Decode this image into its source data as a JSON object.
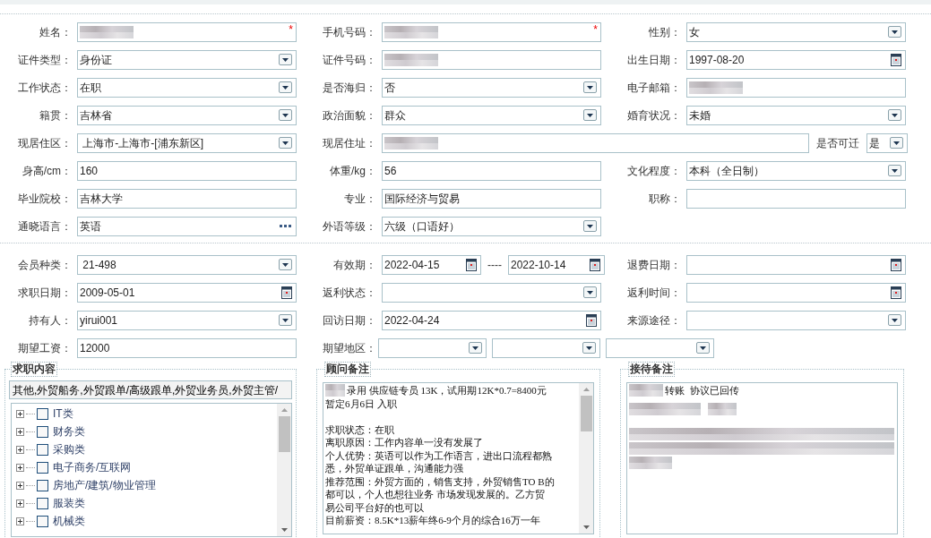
{
  "sections": [
    {
      "rows": [
        [
          {
            "label": "姓名：",
            "kind": "text",
            "redacted": true,
            "marker": "*"
          },
          {
            "label": "手机号码：",
            "kind": "text",
            "redacted": true,
            "marker": "*"
          },
          {
            "label": "性别：",
            "kind": "select",
            "value": "女"
          }
        ],
        [
          {
            "label": "证件类型：",
            "kind": "select",
            "value": "身份证"
          },
          {
            "label": "证件号码：",
            "kind": "text",
            "redacted": true
          },
          {
            "label": "出生日期：",
            "kind": "date",
            "value": "1997-08-20"
          }
        ],
        [
          {
            "label": "工作状态：",
            "kind": "select",
            "value": "在职"
          },
          {
            "label": "是否海归：",
            "kind": "select",
            "value": "否"
          },
          {
            "label": "电子邮箱：",
            "kind": "text",
            "redacted": true
          }
        ],
        [
          {
            "label": "籍贯：",
            "kind": "select",
            "value": "吉林省"
          },
          {
            "label": "政治面貌：",
            "kind": "select",
            "value": "群众"
          },
          {
            "label": "婚育状况：",
            "kind": "select",
            "value": "未婚"
          }
        ],
        [
          {
            "label": "现居住区：",
            "kind": "select",
            "value": " 上海市-上海市-[浦东新区]"
          },
          {
            "label": "现居住址：",
            "kind": "text",
            "redacted": true,
            "inline": {
              "label": "是否可迁",
              "kind": "select",
              "value": "是"
            }
          }
        ],
        [
          {
            "label": "身高/cm：",
            "kind": "text",
            "value": "160"
          },
          {
            "label": "体重/kg：",
            "kind": "text",
            "value": "56"
          },
          {
            "label": "文化程度：",
            "kind": "select",
            "value": "本科（全日制）"
          }
        ],
        [
          {
            "label": "毕业院校：",
            "kind": "text",
            "value": "吉林大学"
          },
          {
            "label": "专业：",
            "kind": "text",
            "value": "国际经济与贸易"
          },
          {
            "label": "职称：",
            "kind": "text"
          }
        ],
        [
          {
            "label": "通晓语言：",
            "kind": "picker",
            "value": "英语"
          },
          {
            "label": "外语等级：",
            "kind": "select",
            "value": "六级（口语好）"
          }
        ]
      ]
    },
    {
      "rows": [
        [
          {
            "label": "会员种类：",
            "kind": "select",
            "value": " 21-498"
          },
          {
            "label": "有效期：",
            "kind": "daterange",
            "values": [
              "2022-04-15",
              "2022-10-14"
            ],
            "separator": "----"
          },
          {
            "label": "退费日期：",
            "kind": "date"
          }
        ],
        [
          {
            "label": "求职日期：",
            "kind": "date",
            "value": "2009-05-01"
          },
          {
            "label": "返利状态：",
            "kind": "select"
          },
          {
            "label": "返利时间：",
            "kind": "date"
          }
        ],
        [
          {
            "label": "持有人：",
            "kind": "select",
            "value": "yirui001"
          },
          {
            "label": "回访日期：",
            "kind": "date",
            "value": "2022-04-24"
          },
          {
            "label": "来源途径：",
            "kind": "select"
          }
        ],
        [
          {
            "label": "期望工资：",
            "kind": "text",
            "value": "12000"
          },
          {
            "label": "期望地区：",
            "kind": "multiselect",
            "dropdowns": [
              {
                "kind": "select"
              },
              {
                "kind": "select"
              },
              {
                "kind": "select"
              }
            ]
          }
        ]
      ]
    }
  ],
  "panels": [
    {
      "kind": "tree",
      "legend": "求职内容",
      "summary": "其他,外贸船务,外贸跟单/高级跟单,外贸业务员,外贸主管/",
      "items": [
        {
          "label": "IT类",
          "checked": false,
          "expanded": false
        },
        {
          "label": "财务类",
          "checked": false,
          "expanded": false
        },
        {
          "label": "采购类",
          "checked": false,
          "expanded": false
        },
        {
          "label": "电子商务/互联网",
          "checked": false,
          "expanded": false
        },
        {
          "label": "房地产/建筑/物业管理",
          "checked": false,
          "expanded": false
        },
        {
          "label": "服装类",
          "checked": false,
          "expanded": false
        },
        {
          "label": "机械类",
          "checked": false,
          "expanded": false
        }
      ]
    },
    {
      "kind": "notes",
      "legend": "顾问备注",
      "redacted_start": true,
      "scrollbar": true,
      "paragraphs": [
        [
          "录用 供应链专员 13K，试用期12K*0.7=8400元",
          "暂定6月6日 入职"
        ],
        [
          "求职状态：在职",
          "离职原因：工作内容单一没有发展了",
          "个人优势：英语可以作为工作语言，进出口流程都熟",
          "悉，外贸单证跟单，沟通能力强",
          "推荐范围：外贸方面的，销售支持，外贸销售TO B的",
          "都可以，个人也想往业务 市场发现发展的。乙方贸",
          "易公司平台好的也可以",
          "目前薪资：8.5K*13薪年终6-9个月的综合16万一年"
        ]
      ]
    },
    {
      "kind": "notes",
      "legend": "接待备注",
      "redacted_start": true,
      "scrollbar": false,
      "redacted_lines": true,
      "paragraphs": [
        [
          "转账  协议已回传"
        ]
      ]
    }
  ]
}
